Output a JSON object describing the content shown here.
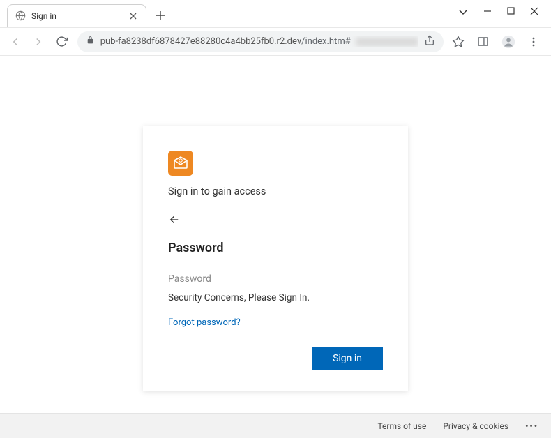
{
  "window": {
    "tab_title": "Sign in"
  },
  "address_bar": {
    "host": "pub-fa8238df6878427e88280c4a4bb25fb0.r2.dev",
    "path": "/index.htm#"
  },
  "card": {
    "heading_1": "Sign in to gain access",
    "heading_2": "Password",
    "password_placeholder": "Password",
    "help_text": "Security Concerns, Please Sign In.",
    "forgot_link": "Forgot password?",
    "submit_label": "Sign in"
  },
  "footer": {
    "terms": "Terms of use",
    "privacy": "Privacy & cookies"
  }
}
